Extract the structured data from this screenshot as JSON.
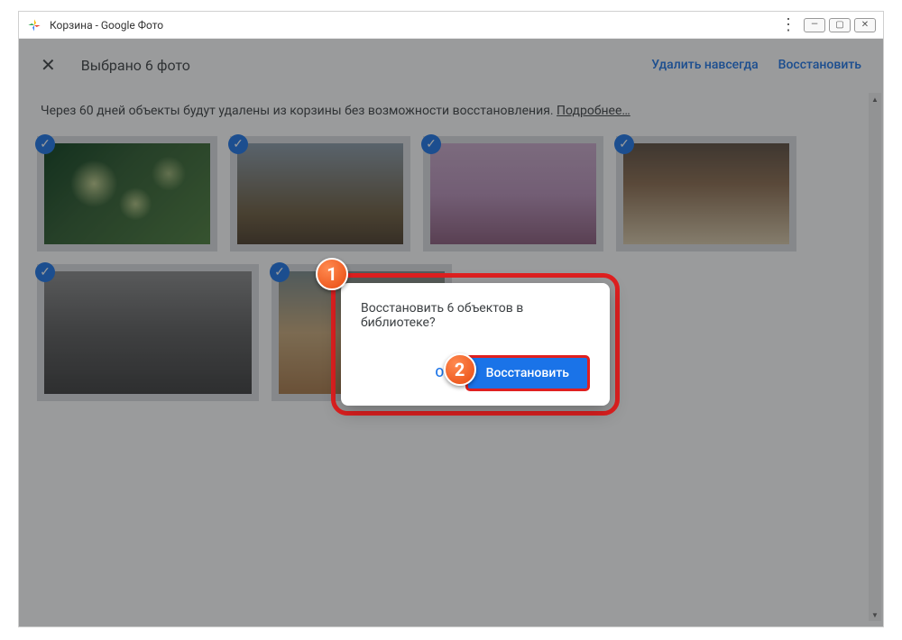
{
  "window": {
    "title": "Корзина - Google Фото"
  },
  "actionbar": {
    "close_icon": "✕",
    "selected": "Выбрано 6 фото",
    "delete": "Удалить навсегда",
    "restore": "Восстановить"
  },
  "info": {
    "text": "Через 60 дней объекты будут удалены из корзины без возможности восстановления. ",
    "more": "Подробнее…"
  },
  "dialog": {
    "question": "Восстановить 6 объектов в библиотеке?",
    "cancel": "Отм",
    "restore": "Восстановить"
  },
  "steps": {
    "s1": "1",
    "s2": "2"
  }
}
